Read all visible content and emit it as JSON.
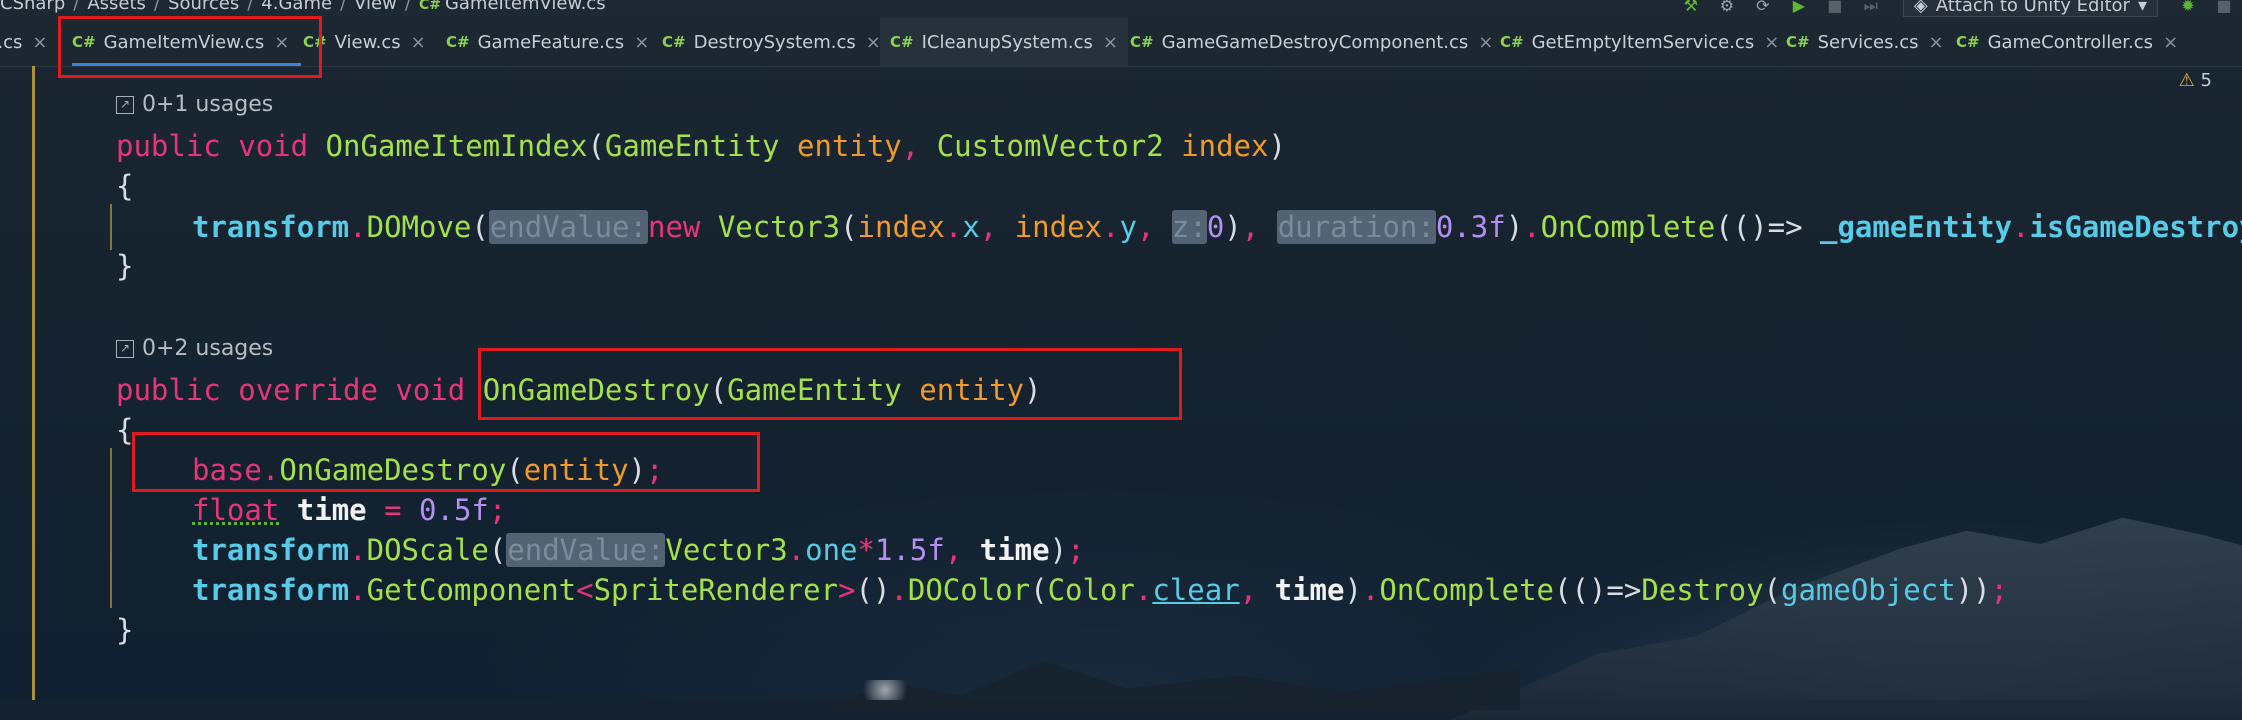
{
  "breadcrumb": [
    "CSharp",
    "Assets",
    "Sources",
    "4.Game",
    "View",
    "GameItemView.cs"
  ],
  "toolbar": {
    "attach_label": "Attach to Unity Editor"
  },
  "tabs": [
    {
      "label": "s.cs",
      "active": false
    },
    {
      "label": "GameItemView.cs",
      "active": true
    },
    {
      "label": "View.cs",
      "active": false
    },
    {
      "label": "GameFeature.cs",
      "active": false
    },
    {
      "label": "DestroySystem.cs",
      "active": false
    },
    {
      "label": "ICleanupSystem.cs",
      "active": false
    },
    {
      "label": "GameGameDestroyComponent.cs",
      "active": false
    },
    {
      "label": "GetEmptyItemService.cs",
      "active": false
    },
    {
      "label": "Services.cs",
      "active": false
    },
    {
      "label": "GameController.cs",
      "active": false
    }
  ],
  "inspection": {
    "count": "5"
  },
  "editor": {
    "usage1": "0+1 usages",
    "usage2": "0+2 usages",
    "lines": {
      "m1_sig": "public void OnGameItemIndex(GameEntity entity, CustomVector2 index)",
      "m1_body": "transform.DOMove(endValue: new Vector3(index.x, index.y, z: 0), duration: 0.3f).OnComplete(()=> _gameEntity.isGameDestroy",
      "m2_sig": "public override void OnGameDestroy(GameEntity entity)",
      "m2_l1": "base.OnGameDestroy(entity);",
      "m2_l2": "float time = 0.5f;",
      "m2_l3": "transform.DOScale(endValue: Vector3.one*1.5f, time);",
      "m2_l4": "transform.GetComponent<SpriteRenderer>().DOColor(Color.clear, time).OnComplete(()=>Destroy(gameObject));"
    }
  },
  "colors": {
    "keyword": "#e8357a",
    "method": "#a3e04a",
    "param": "#f09a2b",
    "property": "#57cbe8",
    "number": "#b48ef0",
    "highlight_box": "#e11b1b"
  }
}
